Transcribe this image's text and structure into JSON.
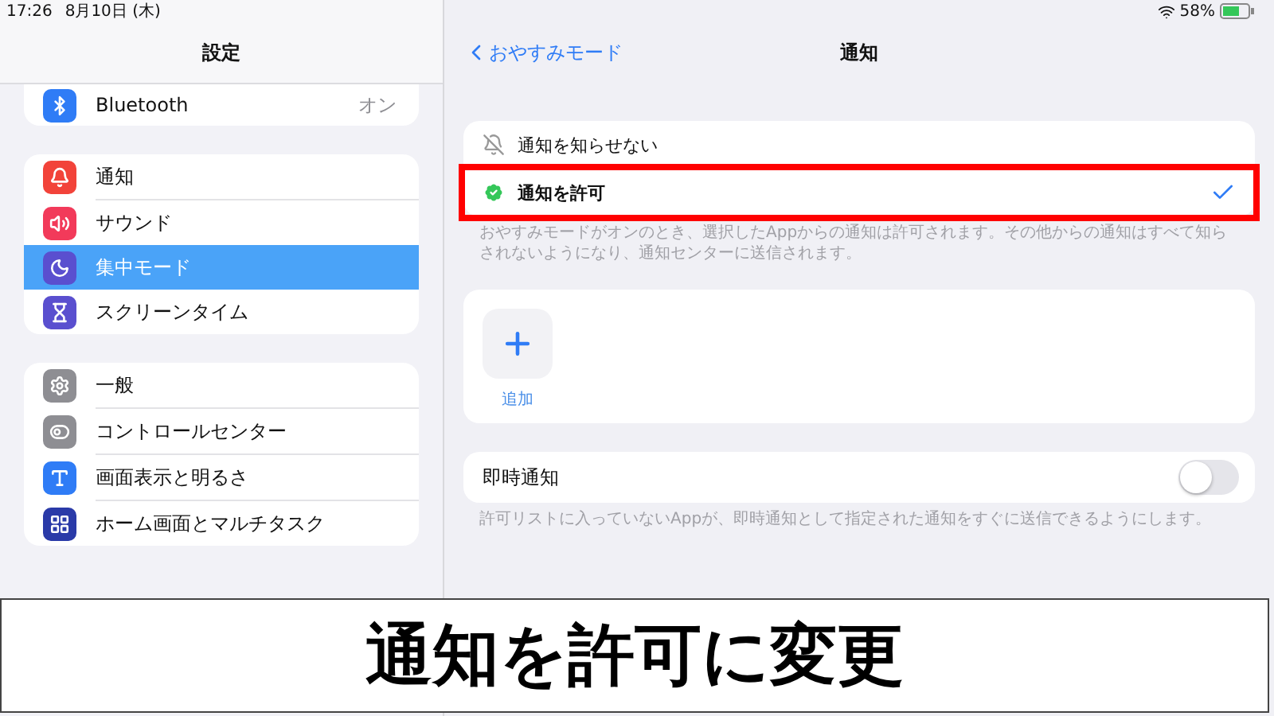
{
  "status_bar": {
    "time": "17:26",
    "date": "8月10日 (木)",
    "battery": "58%"
  },
  "sidebar": {
    "title": "設定",
    "groups": [
      {
        "clipped": true,
        "items": [
          {
            "kind": "bluetooth",
            "label": "Bluetooth",
            "value": "オン",
            "selected": false
          }
        ]
      },
      {
        "clipped": false,
        "items": [
          {
            "kind": "notifications",
            "label": "通知",
            "selected": false
          },
          {
            "kind": "sound",
            "label": "サウンド",
            "selected": false
          },
          {
            "kind": "focus",
            "label": "集中モード",
            "selected": true
          },
          {
            "kind": "screentime",
            "label": "スクリーンタイム",
            "selected": false
          }
        ]
      },
      {
        "clipped": false,
        "items": [
          {
            "kind": "general",
            "label": "一般",
            "selected": false
          },
          {
            "kind": "control",
            "label": "コントロールセンター",
            "selected": false
          },
          {
            "kind": "display",
            "label": "画面表示と明るさ",
            "selected": false
          },
          {
            "kind": "home",
            "label": "ホーム画面とマルチタスク",
            "selected": false
          }
        ]
      }
    ]
  },
  "detail": {
    "back_label": "おやすみモード",
    "title": "通知",
    "options": [
      {
        "kind": "silence",
        "label": "通知を知らせない",
        "selected": false,
        "highlighted": false
      },
      {
        "kind": "allow",
        "label": "通知を許可",
        "selected": true,
        "highlighted": true
      }
    ],
    "options_note": "おやすみモードがオンのとき、選択したAppからの通知は許可されます。その他からの通知はすべて知らされないようになり、通知センターに送信されます。",
    "add_label": "追加",
    "instant": {
      "label": "即時通知",
      "on": false
    },
    "instant_note": "許可リストに入っていないAppが、即時通知として指定された通知をすぐに送信できるようにします。"
  },
  "caption": "通知を許可に変更"
}
